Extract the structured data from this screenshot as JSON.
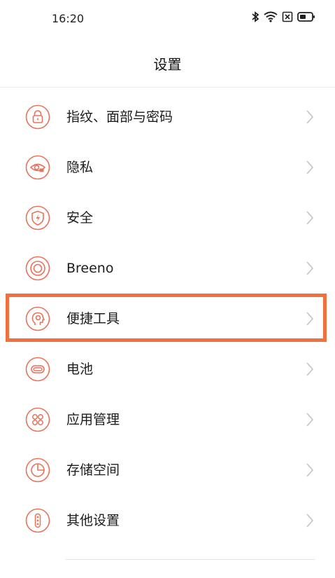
{
  "status_bar": {
    "time": "16:20",
    "icons": [
      "bluetooth-icon",
      "wifi-icon",
      "sim-x-icon",
      "battery-icon"
    ]
  },
  "header": {
    "title": "设置"
  },
  "theme": {
    "accent": "#e8735a",
    "highlight_border": "#f07040"
  },
  "menu": {
    "items": [
      {
        "label": "指纹、面部与密码",
        "icon": "lock-icon"
      },
      {
        "label": "隐私",
        "icon": "eye-lock-icon"
      },
      {
        "label": "安全",
        "icon": "shield-bolt-icon"
      },
      {
        "label": "Breeno",
        "icon": "breeno-circle-icon"
      },
      {
        "label": "便捷工具",
        "icon": "head-target-icon"
      },
      {
        "label": "电池",
        "icon": "battery-icon"
      },
      {
        "label": "应用管理",
        "icon": "apps-grid-icon"
      },
      {
        "label": "存储空间",
        "icon": "pie-chart-icon"
      },
      {
        "label": "其他设置",
        "icon": "more-dots-icon"
      }
    ]
  }
}
